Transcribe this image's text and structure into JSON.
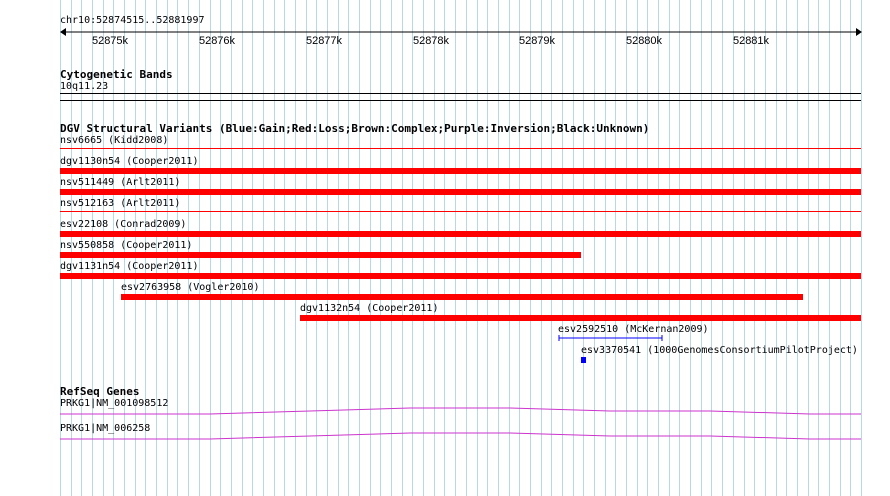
{
  "ruler": {
    "label": "chr10:52874515..52881997",
    "ticks": [
      "52875k",
      "52876k",
      "52877k",
      "52878k",
      "52879k",
      "52880k",
      "52881k"
    ]
  },
  "cytogenetic": {
    "title": "Cytogenetic Bands",
    "band": "10q11.23"
  },
  "dgv": {
    "title": "DGV Structural Variants (Blue:Gain;Red:Loss;Brown:Complex;Purple:Inversion;Black:Unknown)",
    "variants": [
      {
        "label": "nsv6665 (Kidd2008)"
      },
      {
        "label": "dgv1130n54 (Cooper2011)"
      },
      {
        "label": "nsv511449 (Arlt2011)"
      },
      {
        "label": "nsv512163 (Arlt2011)"
      },
      {
        "label": "esv22108 (Conrad2009)"
      },
      {
        "label": "nsv550858 (Cooper2011)"
      },
      {
        "label": "dgv1131n54 (Cooper2011)"
      },
      {
        "label": "esv2763958 (Vogler2010)"
      },
      {
        "label": "dgv1132n54 (Cooper2011)"
      },
      {
        "label": "esv2592510 (McKernan2009)"
      },
      {
        "label": "esv3370541 (1000GenomesConsortiumPilotProject)"
      }
    ]
  },
  "refseq": {
    "title": "RefSeq Genes",
    "genes": [
      {
        "label": "PRKG1|NM_001098512"
      },
      {
        "label": "PRKG1|NM_006258"
      }
    ]
  },
  "colors": {
    "loss": "#ff0000",
    "gain": "#0000ff",
    "gene": "#cc33cc",
    "grid": "#b8d8e8"
  }
}
